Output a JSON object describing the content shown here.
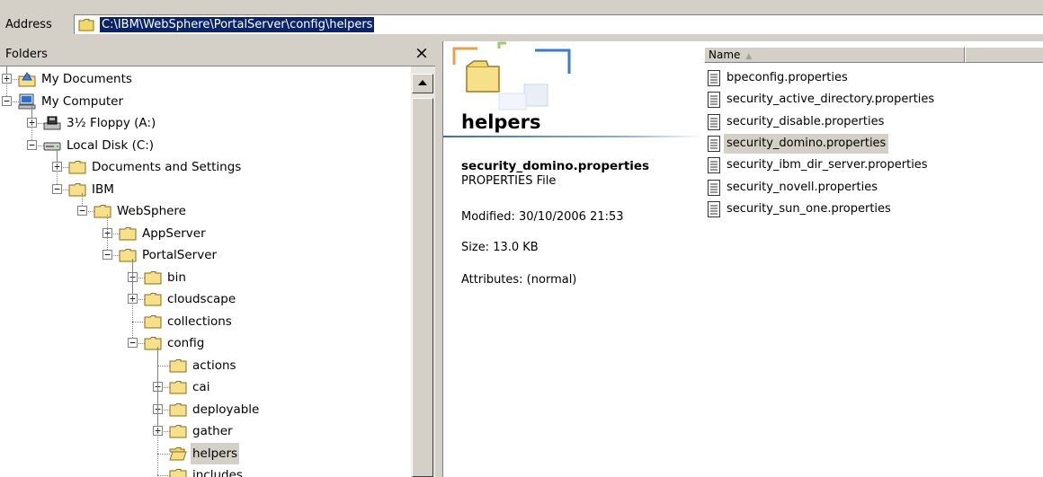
{
  "address": {
    "label": "Address",
    "path": "C:\\IBM\\WebSphere\\PortalServer\\config\\helpers"
  },
  "folders_panel": {
    "title": "Folders",
    "close_glyph": "×",
    "tree": [
      {
        "label": "My Documents",
        "icon": "my-documents-icon",
        "expander": "+"
      },
      {
        "label": "My Computer",
        "icon": "my-computer-icon",
        "expander": "−"
      },
      {
        "label": "3½ Floppy (A:)",
        "icon": "floppy-drive-icon",
        "expander": "+"
      },
      {
        "label": "Local Disk (C:)",
        "icon": "local-disk-icon",
        "expander": "−"
      },
      {
        "label": "Documents and Settings",
        "icon": "folder-icon",
        "expander": "+"
      },
      {
        "label": "IBM",
        "icon": "folder-icon",
        "expander": "−"
      },
      {
        "label": "WebSphere",
        "icon": "folder-icon",
        "expander": "−"
      },
      {
        "label": "AppServer",
        "icon": "folder-icon",
        "expander": "+"
      },
      {
        "label": "PortalServer",
        "icon": "folder-icon",
        "expander": "−"
      },
      {
        "label": "bin",
        "icon": "folder-icon",
        "expander": "+"
      },
      {
        "label": "cloudscape",
        "icon": "folder-icon",
        "expander": "+"
      },
      {
        "label": "collections",
        "icon": "folder-icon",
        "expander": ""
      },
      {
        "label": "config",
        "icon": "folder-icon",
        "expander": "−"
      },
      {
        "label": "actions",
        "icon": "folder-icon",
        "expander": ""
      },
      {
        "label": "cai",
        "icon": "folder-icon",
        "expander": "+"
      },
      {
        "label": "deployable",
        "icon": "folder-icon",
        "expander": "+"
      },
      {
        "label": "gather",
        "icon": "folder-icon",
        "expander": "+"
      },
      {
        "label": "helpers",
        "icon": "open-folder-icon",
        "expander": "",
        "selected": true
      },
      {
        "label": "includes",
        "icon": "folder-icon",
        "expander": ""
      }
    ]
  },
  "details": {
    "folder_title": "helpers",
    "file_name": "security_domino.properties",
    "file_type": "PROPERTIES File",
    "modified": "Modified: 30/10/2006 21:53",
    "size": "Size: 13.0 KB",
    "attributes": "Attributes: (normal)"
  },
  "file_list": {
    "column_name": "Name",
    "sort_indicator": "▲",
    "files": [
      {
        "name": "bpeconfig.properties",
        "selected": false
      },
      {
        "name": "security_active_directory.properties",
        "selected": false
      },
      {
        "name": "security_disable.properties",
        "selected": false
      },
      {
        "name": "security_domino.properties",
        "selected": true
      },
      {
        "name": "security_ibm_dir_server.properties",
        "selected": false
      },
      {
        "name": "security_novell.properties",
        "selected": false
      },
      {
        "name": "security_sun_one.properties",
        "selected": false
      }
    ]
  },
  "colors": {
    "selection_highlight": "#0a246a",
    "inactive_selection": "#d4d0c8",
    "folder_yellow": "#f3d86a"
  }
}
